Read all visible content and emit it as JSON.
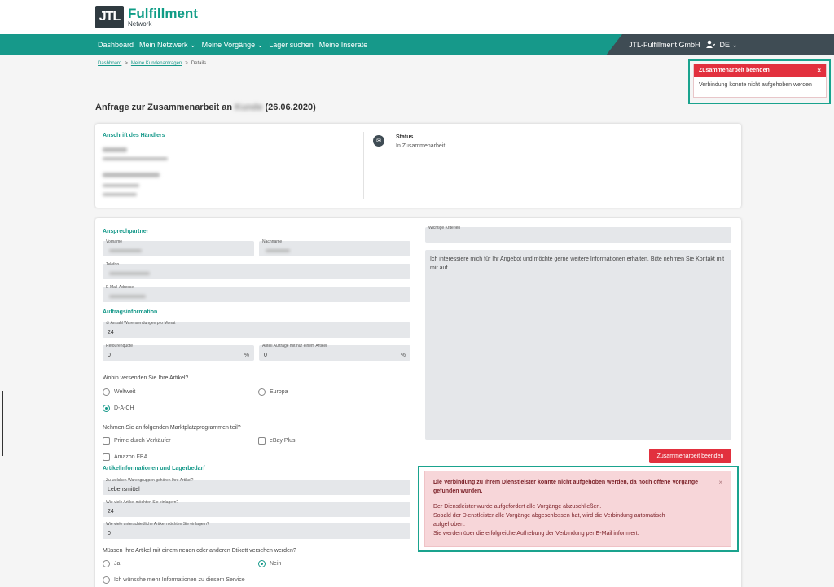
{
  "header": {
    "logo_mark": "JTL",
    "logo_title": "Fulfillment",
    "logo_subtitle": "Network"
  },
  "nav": {
    "items": [
      "Dashboard",
      "Mein Netzwerk ⌄",
      "Meine Vorgänge ⌄",
      "Lager suchen",
      "Meine Inserate"
    ],
    "company": "JTL-Fulfillment GmbH",
    "user_icon": "user-icon",
    "language": "DE ⌄"
  },
  "breadcrumb": {
    "items": [
      "Dashboard",
      "Meine Kundenanfragen",
      "Details"
    ],
    "separator": ">"
  },
  "toast": {
    "title": "Zusammenarbeit beenden",
    "close": "×",
    "message": "Verbindung konnte nicht aufgehoben werden"
  },
  "page": {
    "title_prefix": "Anfrage zur Zusammenarbeit an",
    "title_name": "Kunde",
    "title_suffix": "(26.06.2020)"
  },
  "address_card": {
    "title": "Anschrift des Händlers",
    "status_label": "Status",
    "status_value": "In Zusammenarbeit",
    "status_icon": "envelope-icon"
  },
  "contact": {
    "title": "Ansprechpartner",
    "vorname_label": "Vorname",
    "nachname_label": "Nachname",
    "telefon_label": "Telefon",
    "email_label": "E-Mail-Adresse"
  },
  "order": {
    "title": "Auftragsinformation",
    "shipments_label": "∅ Anzahl Warensendungen pro Monat",
    "shipments_value": "24",
    "returns_label": "Retourenquote",
    "returns_value": "0",
    "returns_unit": "%",
    "single_label": "Anteil Aufträge mit nur einem Artikel",
    "single_value": "0",
    "single_unit": "%"
  },
  "shipping": {
    "question": "Wohin versenden Sie Ihre Artikel?",
    "options": [
      "Weltweit",
      "Europa",
      "D-A-CH"
    ],
    "selected": "D-A-CH"
  },
  "marketplace": {
    "question": "Nehmen Sie an folgenden Marktplatzprogrammen teil?",
    "options": [
      "Prime durch Verkäufer",
      "eBay Plus",
      "Amazon FBA"
    ]
  },
  "articles": {
    "title": "Artikelinformationen und Lagerbedarf",
    "group_label": "Zu welchen Warengruppen gehören Ihre Artikel?",
    "group_value": "Lebensmittel",
    "count_label": "Wie viele Artikel möchten Sie einlagern?",
    "count_value": "24",
    "distinct_label": "Wie viele unterschiedliche Artikel möchten Sie einlagern?",
    "distinct_value": "0"
  },
  "labeling": {
    "question": "Müssen Ihre Artikel mit einem neuen oder anderen Etikett versehen werden?",
    "options": [
      "Ja",
      "Nein",
      "Ich wünsche mehr Informationen zu diesem Service"
    ],
    "selected": "Nein"
  },
  "criteria": {
    "label": "Wichtige Kriterien",
    "message": "Ich interessiere mich für Ihr Angebot und möchte gerne weitere Informationen erhalten. Bitte nehmen Sie Kontakt mit mir auf."
  },
  "actions": {
    "end_button": "Zusammenarbeit beenden"
  },
  "alert": {
    "headline": "Die Verbindung zu Ihrem Dienstleister konnte nicht aufgehoben werden, da noch offene Vorgänge gefunden wurden.",
    "line1": "Der Dienstleister wurde aufgefordert alle Vorgänge abzuschließen.",
    "line2": "Sobald der Dienstleister alle Vorgänge abgeschlossen hat, wird die Verbindung automatisch aufgehoben.",
    "line3": "Sie werden über die erfolgreiche Aufhebung der Verbindung per E-Mail informiert.",
    "close": "×"
  },
  "colors": {
    "brand": "#16998a",
    "nav_dark": "#3f4c54",
    "danger": "#e2303e",
    "alert_bg": "#f7d6d9",
    "highlight": "#1aa38e"
  }
}
